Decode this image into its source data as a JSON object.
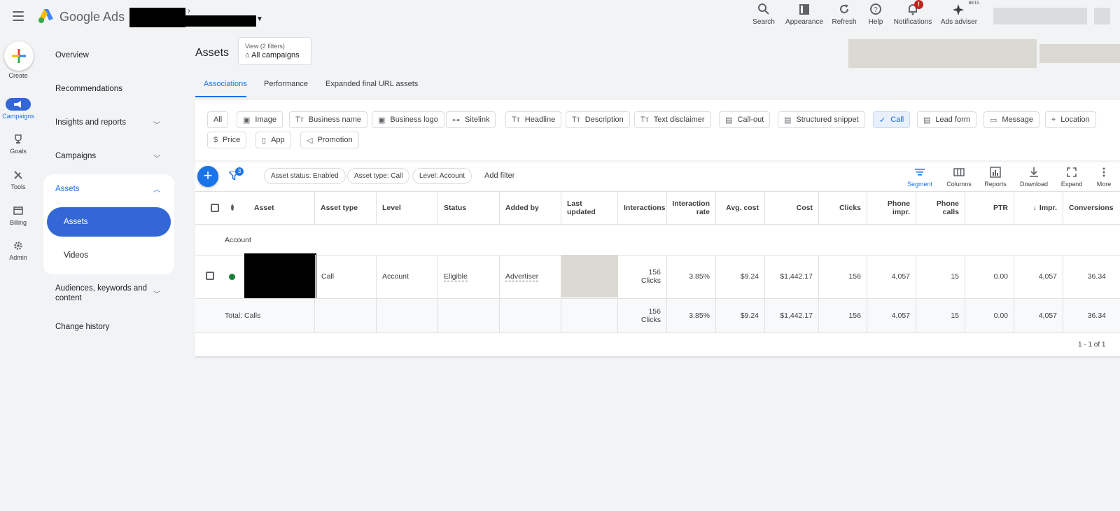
{
  "app": {
    "brand": "Google Ads"
  },
  "top_bar": {
    "actions": [
      {
        "label": "Search",
        "icon": "search-icon"
      },
      {
        "label": "Appearance",
        "icon": "appearance-icon"
      },
      {
        "label": "Refresh",
        "icon": "refresh-icon"
      },
      {
        "label": "Help",
        "icon": "help-icon"
      },
      {
        "label": "Notifications",
        "icon": "bell-icon",
        "badge": "!"
      },
      {
        "label": "Ads adviser",
        "icon": "sparkle-icon",
        "badge": "BETA"
      }
    ]
  },
  "rail": {
    "create": "Create",
    "items": [
      {
        "label": "Campaigns",
        "icon": "megaphone-icon",
        "active": true
      },
      {
        "label": "Goals",
        "icon": "trophy-icon"
      },
      {
        "label": "Tools",
        "icon": "tools-icon"
      },
      {
        "label": "Billing",
        "icon": "card-icon"
      },
      {
        "label": "Admin",
        "icon": "gear-icon"
      }
    ]
  },
  "nav": {
    "overview": "Overview",
    "recommendations": "Recommendations",
    "insights": "Insights and reports",
    "campaigns": "Campaigns",
    "assets": "Assets",
    "assets_sub": "Assets",
    "videos": "Videos",
    "audiences_1": "Audiences, keywords and",
    "audiences_2": "content",
    "change_history": "Change history"
  },
  "header": {
    "title": "Assets",
    "view_label": "View (2 filters)",
    "view_value": "All campaigns"
  },
  "tabs": [
    "Associations",
    "Performance",
    "Expanded final URL assets"
  ],
  "asset_chips": [
    {
      "label": "All"
    },
    {
      "label": "Image",
      "icon": "▣"
    },
    {
      "label": "Business name",
      "icon": "Tт"
    },
    {
      "label": "Business logo",
      "icon": "▣"
    },
    {
      "label": "Sitelink",
      "icon": "⊶"
    },
    {
      "label": "Headline",
      "icon": "Tт"
    },
    {
      "label": "Description",
      "icon": "Tт"
    },
    {
      "label": "Text disclaimer",
      "icon": "Tт"
    },
    {
      "label": "Call-out",
      "icon": "▤"
    },
    {
      "label": "Structured snippet",
      "icon": "▤"
    },
    {
      "label": "Call",
      "icon": "✓",
      "selected": true
    },
    {
      "label": "Lead form",
      "icon": "▤"
    },
    {
      "label": "Message",
      "icon": "▭"
    },
    {
      "label": "Location",
      "icon": "⌖"
    },
    {
      "label": "Price",
      "icon": "$"
    },
    {
      "label": "App",
      "icon": "▯"
    },
    {
      "label": "Promotion",
      "icon": "◁"
    }
  ],
  "filters": {
    "count": "3",
    "chips": [
      "Asset status: Enabled",
      "Asset type: Call",
      "Level: Account"
    ],
    "add": "Add filter"
  },
  "toolbar": [
    "Segment",
    "Columns",
    "Reports",
    "Download",
    "Expand",
    "More"
  ],
  "table": {
    "headers": {
      "asset": "Asset",
      "asset_type": "Asset type",
      "level": "Level",
      "status": "Status",
      "added_by": "Added by",
      "last_updated": "Last updated",
      "interactions": "Interactions",
      "interaction_rate": "Interaction rate",
      "avg_cost": "Avg. cost",
      "cost": "Cost",
      "clicks": "Clicks",
      "phone_impr": "Phone impr.",
      "phone_calls": "Phone calls",
      "ptr": "PTR",
      "impr": "Impr.",
      "conversions": "Conversions"
    },
    "group_label": "Account",
    "row": {
      "asset_type": "Call",
      "level": "Account",
      "status": "Eligible",
      "added_by": "Advertiser",
      "interactions_1": "156",
      "interactions_2": "Clicks",
      "interaction_rate": "3.85%",
      "avg_cost": "$9.24",
      "cost": "$1,442.17",
      "clicks": "156",
      "phone_impr": "4,057",
      "phone_calls": "15",
      "ptr": "0.00",
      "impr": "4,057",
      "conversions": "36.34"
    },
    "total": {
      "label": "Total: Calls",
      "interactions_1": "156",
      "interactions_2": "Clicks",
      "interaction_rate": "3.85%",
      "avg_cost": "$9.24",
      "cost": "$1,442.17",
      "clicks": "156",
      "phone_impr": "4,057",
      "phone_calls": "15",
      "ptr": "0.00",
      "impr": "4,057",
      "conversions": "36.34"
    },
    "pagination": "1 - 1 of 1"
  }
}
